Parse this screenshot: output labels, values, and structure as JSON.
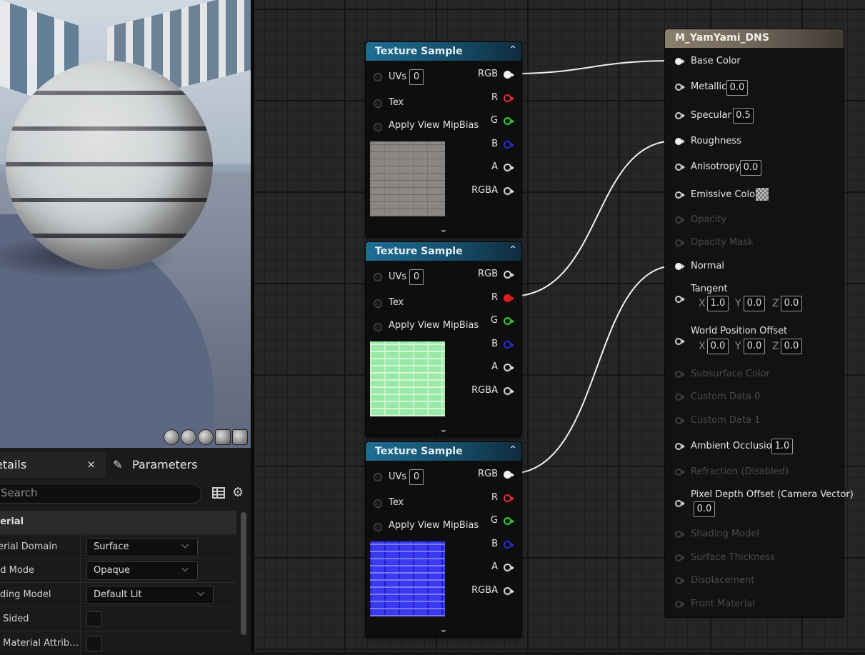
{
  "details": {
    "tab_details": "etails",
    "tab_close": "×",
    "tab_parameters": "Parameters",
    "search_placeholder": "Search",
    "section_title": "terial",
    "properties": [
      {
        "label": "terial Domain",
        "value": "Surface"
      },
      {
        "label": "nd Mode",
        "value": "Opaque"
      },
      {
        "label": "ading Model",
        "value": "Default Lit"
      },
      {
        "label": "o Sided",
        "value": ""
      },
      {
        "label": "e Material Attrib…",
        "value": ""
      }
    ]
  },
  "texture_nodes": [
    {
      "title": "Texture Sample",
      "inputs": [
        {
          "label": "UVs",
          "value": "0"
        },
        {
          "label": "Tex"
        },
        {
          "label": "Apply View MipBias"
        }
      ],
      "outputs": [
        "RGB",
        "R",
        "G",
        "B",
        "A",
        "RGBA"
      ],
      "preview": "diffuse-bricks"
    },
    {
      "title": "Texture Sample",
      "inputs": [
        {
          "label": "UVs",
          "value": "0"
        },
        {
          "label": "Tex"
        },
        {
          "label": "Apply View MipBias"
        }
      ],
      "outputs": [
        "RGB",
        "R",
        "G",
        "B",
        "A",
        "RGBA"
      ],
      "preview": "roughness-bricks"
    },
    {
      "title": "Texture Sample",
      "inputs": [
        {
          "label": "UVs",
          "value": "0"
        },
        {
          "label": "Tex"
        },
        {
          "label": "Apply View MipBias"
        }
      ],
      "outputs": [
        "RGB",
        "R",
        "G",
        "B",
        "A",
        "RGBA"
      ],
      "preview": "normal-bricks"
    }
  ],
  "pin_colors": {
    "R": "#e03030",
    "G": "#30d030",
    "B": "#2a2ad8",
    "A": "#d8d8d8",
    "RGB": "#f0f0f0",
    "RGBA": "#d8d8d8"
  },
  "result_node": {
    "title": "M_YamYami_DNS",
    "pins": {
      "base_color": "Base Color",
      "metallic": "Metallic",
      "metallic_value": "0.0",
      "specular": "Specular",
      "specular_value": "0.5",
      "roughness": "Roughness",
      "anisotropy": "Anisotropy",
      "anisotropy_value": "0.0",
      "emissive": "Emissive Color",
      "opacity": "Opacity",
      "opacity_mask": "Opacity Mask",
      "normal": "Normal",
      "tangent": "Tangent",
      "tangent_x": "1.0",
      "tangent_y": "0.0",
      "tangent_z": "0.0",
      "wpo": "World Position Offset",
      "wpo_x": "0.0",
      "wpo_y": "0.0",
      "wpo_z": "0.0",
      "subsurface": "Subsurface Color",
      "custom0": "Custom Data 0",
      "custom1": "Custom Data 1",
      "ao": "Ambient Occlusion",
      "ao_value": "1.0",
      "refraction": "Refraction (Disabled)",
      "pdo": "Pixel Depth Offset (Camera Vector)",
      "pdo_value": "0.0",
      "shading_model": "Shading Model",
      "surface_thickness": "Surface Thickness",
      "displacement": "Displacement",
      "front_material": "Front Material"
    },
    "axis_labels": {
      "x": "X",
      "y": "Y",
      "z": "Z"
    }
  }
}
